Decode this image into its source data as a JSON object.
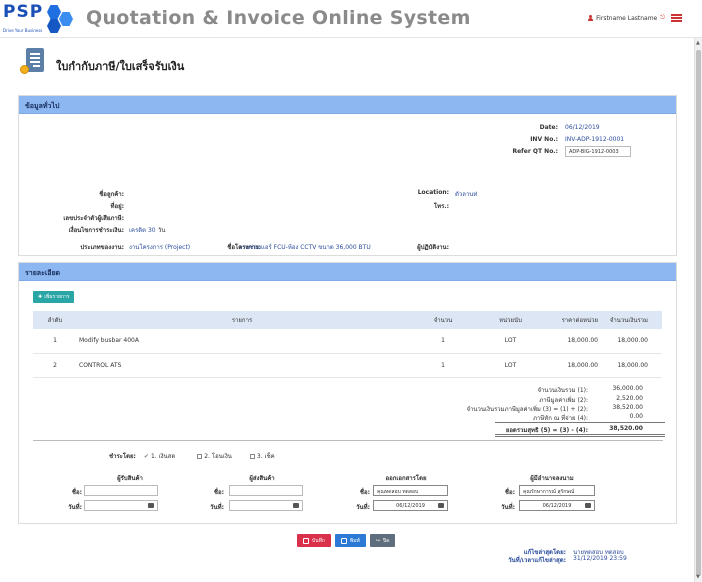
{
  "header": {
    "logo_text": "PSP",
    "logo_tagline": "Drive Your Business",
    "app_title": "Quotation & Invoice Online System",
    "user_name": "Firstname  Lastname"
  },
  "page": {
    "title": "ใบกำกับภาษี/ใบเสร็จรับเงิน"
  },
  "general": {
    "section_title": "ข้อมูลทั่วไป",
    "date_label": "Date:",
    "date_value": "06/12/2019",
    "inv_label": "INV No.:",
    "inv_value": "INV-ADP-1912-0001",
    "refer_label": "Refer QT No.:",
    "refer_value": "ADP-BIG-1912-0003",
    "customer_label": "ชื่อลูกค้า:",
    "address_label": "ที่อยู่:",
    "taxid_label": "เลขประจำตัวผู้เสียภาษี:",
    "credit_label": "เงื่อนไขการชำระเงิน:",
    "credit_value": "เครดิต 30",
    "credit_unit": "วัน",
    "location_label": "Location:",
    "location_value": "ตัวลานท่",
    "phone_label": "โทร.:",
    "jobtype_label": "ประเภทของงาน:",
    "jobtype_value": "งานโครงการ (Project)",
    "project_label": "ชื่อโครงการ:",
    "project_value": "งานซ่อมแอร์ FCU-ห้อง CCTV ขนาด 36,000 BTU",
    "operator_label": "ผู้ปฏิบัติงาน:"
  },
  "detail": {
    "section_title": "รายละเอียด",
    "add_button": "เพิ่มรายการ",
    "columns": [
      "ลำดับ",
      "รายการ",
      "จำนวน",
      "หน่วยนับ",
      "ราคาต่อหน่วย",
      "จำนวนเงินรวม"
    ],
    "rows": [
      {
        "no": "1",
        "item": "Modify busbar 400A",
        "qty": "1",
        "unit": "LOT",
        "price": "18,000.00",
        "amount": "18,000.00"
      },
      {
        "no": "2",
        "item": "CONTROL ATS",
        "qty": "1",
        "unit": "LOT",
        "price": "18,000.00",
        "amount": "18,000.00"
      }
    ],
    "summary": [
      {
        "label": "จำนวนเงินรวม (1):",
        "value": "36,000.00"
      },
      {
        "label": "ภาษีมูลค่าเพิ่ม (2):",
        "value": "2,520.00"
      },
      {
        "label": "จำนวนเงินรวมภาษีมูลค่าเพิ่ม (3) = (1) + (2):",
        "value": "38,520.00"
      },
      {
        "label": "ภาษีหัก ณ ที่จ่าย (4):",
        "value": "0.00"
      }
    ],
    "net_label": "ยอดรวมสุทธิ (5) = (3) - (4):",
    "net_value": "38,520.00",
    "payment_label": "ชำระโดย:",
    "payment_options": [
      "1. เงินสด",
      "2. โอนเงิน",
      "3. เช็ค"
    ],
    "signatures": [
      {
        "title": "ผู้รับสินค้า",
        "name": "",
        "date": ""
      },
      {
        "title": "ผู้ส่งสินค้า",
        "name": "",
        "date": ""
      },
      {
        "title": "ออกเอกสารโดย",
        "name": "คุณทดสอบ ทดสอบ",
        "date": "06/12/2019"
      },
      {
        "title": "ผู้มีอำนาจลงนาม",
        "name": "คุณรักษาการณ์ สุรักษณ์",
        "date": "06/12/2019"
      }
    ],
    "name_label": "ชื่อ:",
    "date_label": "วันที่:"
  },
  "buttons": {
    "save": "บันทึก",
    "print": "พิมพ์",
    "close": "ปิด"
  },
  "audit": {
    "edited_by_label": "แก้ไขล่าสุดโดย:",
    "edited_by_value": "นายทดสอบ ทดสอบ",
    "edited_at_label": "วันที่/เวลาแก้ไขล่าสุด:",
    "edited_at_value": "31/12/2019 23:59"
  },
  "colors": {
    "panel_header": "#8db7f0",
    "link": "#2a4c9b",
    "save": "#d9304b",
    "print": "#2d7ad6",
    "close": "#5f6e7c",
    "add": "#2aa6a6"
  }
}
